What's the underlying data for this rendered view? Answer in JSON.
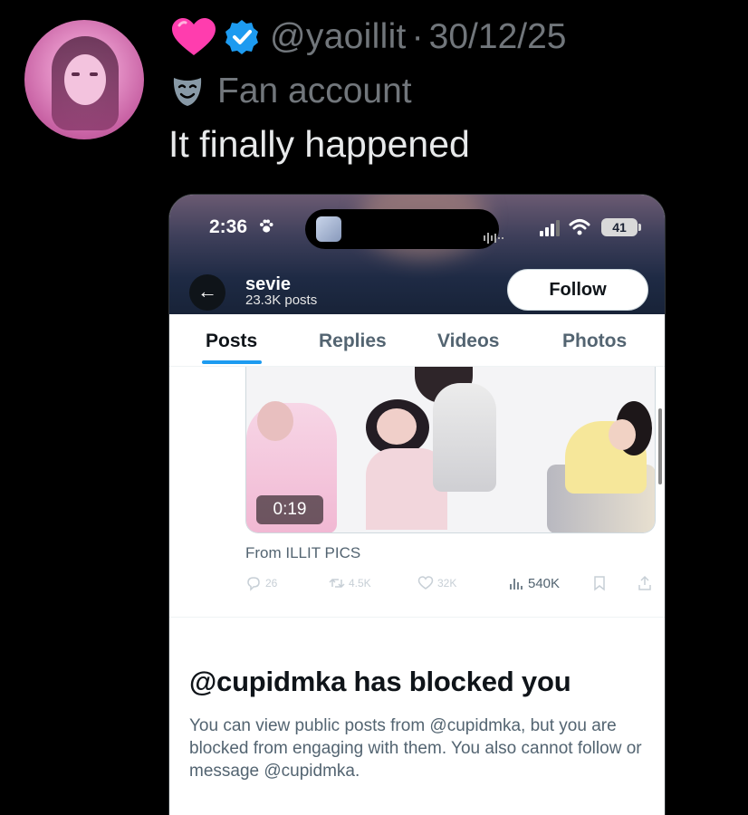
{
  "tweet": {
    "handle": "@yaoillit",
    "separator": "·",
    "date": "30/12/25",
    "label": "Fan account",
    "text": "It finally happened",
    "icons": [
      "heart-emoji-icon",
      "verified-badge-icon",
      "performing-arts-mask-icon"
    ]
  },
  "screenshot": {
    "status_bar": {
      "time": "2:36",
      "battery": "41"
    },
    "profile": {
      "name": "sevie",
      "posts": "23.3K posts",
      "follow_label": "Follow"
    },
    "tabs": [
      "Posts",
      "Replies",
      "Videos",
      "Photos"
    ],
    "active_tab": "Posts",
    "post": {
      "duration": "0:19",
      "from": "From ILLIT PICS",
      "replies": "26",
      "reposts": "4.5K",
      "likes": "32K",
      "views": "540K"
    },
    "blocked": {
      "title": "@cupidmka has blocked you",
      "body": "You can view public posts from @cupidmka, but you are blocked from engaging with them. You also cannot follow or message @cupidmka."
    }
  },
  "colors": {
    "background": "#000000",
    "text_primary": "#e7e9ea",
    "text_secondary": "#71767b",
    "verified_blue": "#1d9bf0",
    "heart_pink": "#ff3dae"
  }
}
